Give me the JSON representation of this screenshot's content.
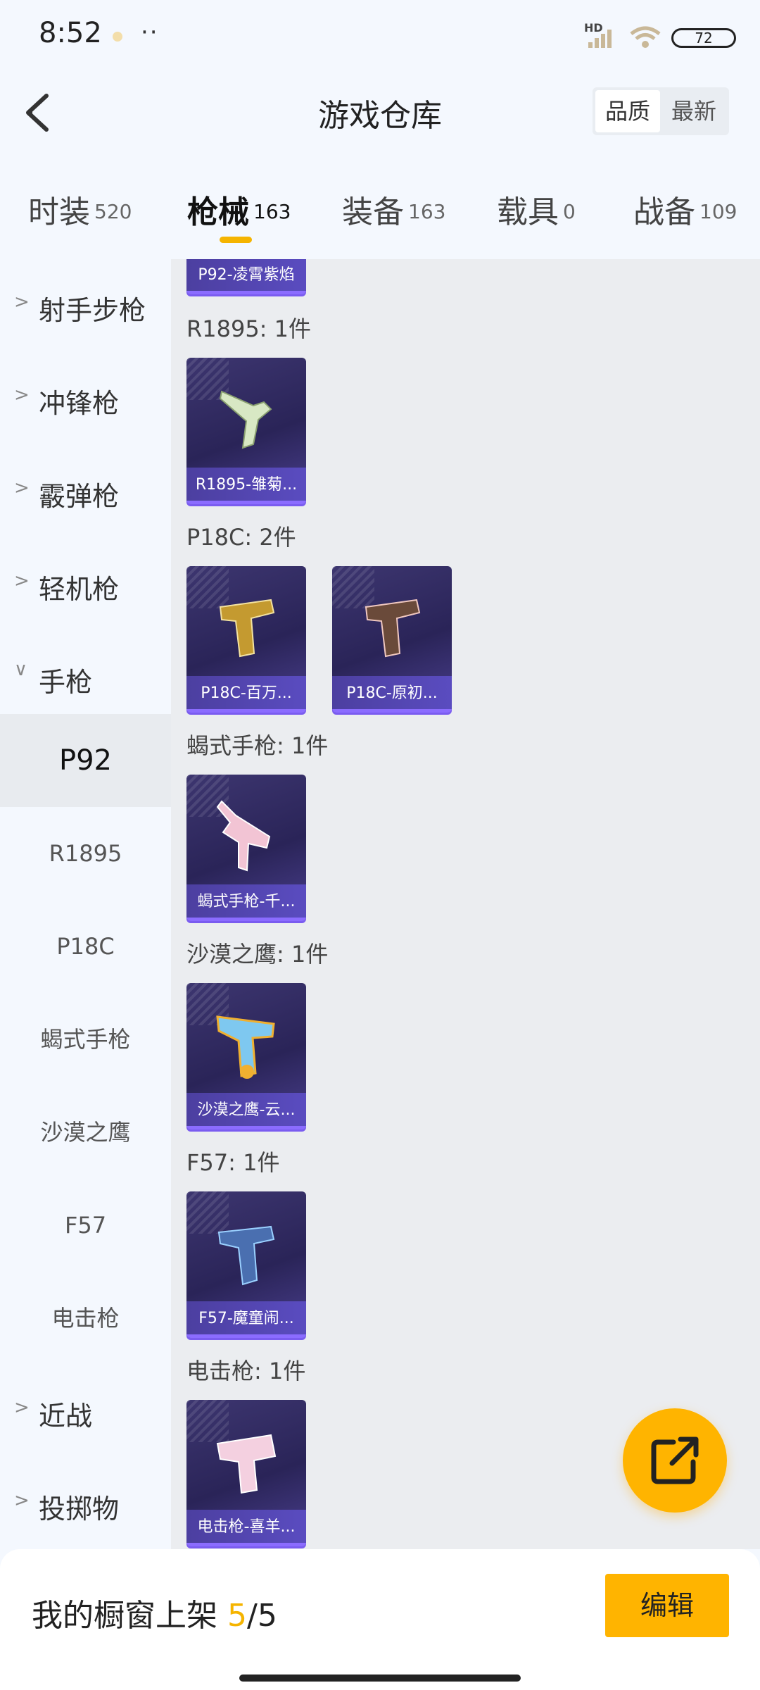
{
  "status": {
    "time": "8:52",
    "battery": "72",
    "network": "HD"
  },
  "header": {
    "title": "游戏仓库",
    "sort": [
      "品质",
      "最新"
    ]
  },
  "tabs": [
    {
      "name": "时装",
      "count": "520"
    },
    {
      "name": "枪械",
      "count": "163"
    },
    {
      "name": "装备",
      "count": "163"
    },
    {
      "name": "载具",
      "count": "0"
    },
    {
      "name": "战备",
      "count": "109"
    }
  ],
  "sidebar": {
    "categories": [
      "射手步枪",
      "冲锋枪",
      "霰弹枪",
      "轻机枪",
      "手枪"
    ],
    "subs": [
      "P92",
      "R1895",
      "P18C",
      "蝎式手枪",
      "沙漠之鹰",
      "F57",
      "电击枪"
    ],
    "tail": [
      "近战",
      "投掷物"
    ]
  },
  "content": {
    "top_card": "P92-凌霄紫焰",
    "groups": [
      {
        "title": "R1895: 1件",
        "items": [
          "R1895-雏菊..."
        ]
      },
      {
        "title": "P18C: 2件",
        "items": [
          "P18C-百万...",
          "P18C-原初..."
        ]
      },
      {
        "title": "蝎式手枪: 1件",
        "items": [
          "蝎式手枪-千..."
        ]
      },
      {
        "title": "沙漠之鹰: 1件",
        "items": [
          "沙漠之鹰-云..."
        ]
      },
      {
        "title": "F57: 1件",
        "items": [
          "F57-魔童闹..."
        ]
      },
      {
        "title": "电击枪: 1件",
        "items": [
          "电击枪-喜羊..."
        ]
      }
    ]
  },
  "bottom": {
    "label": "我的橱窗上架 ",
    "used": "5",
    "total": "/5",
    "edit": "编辑"
  },
  "colors": {
    "accent": "#ffb400",
    "card": "#2a2458"
  }
}
